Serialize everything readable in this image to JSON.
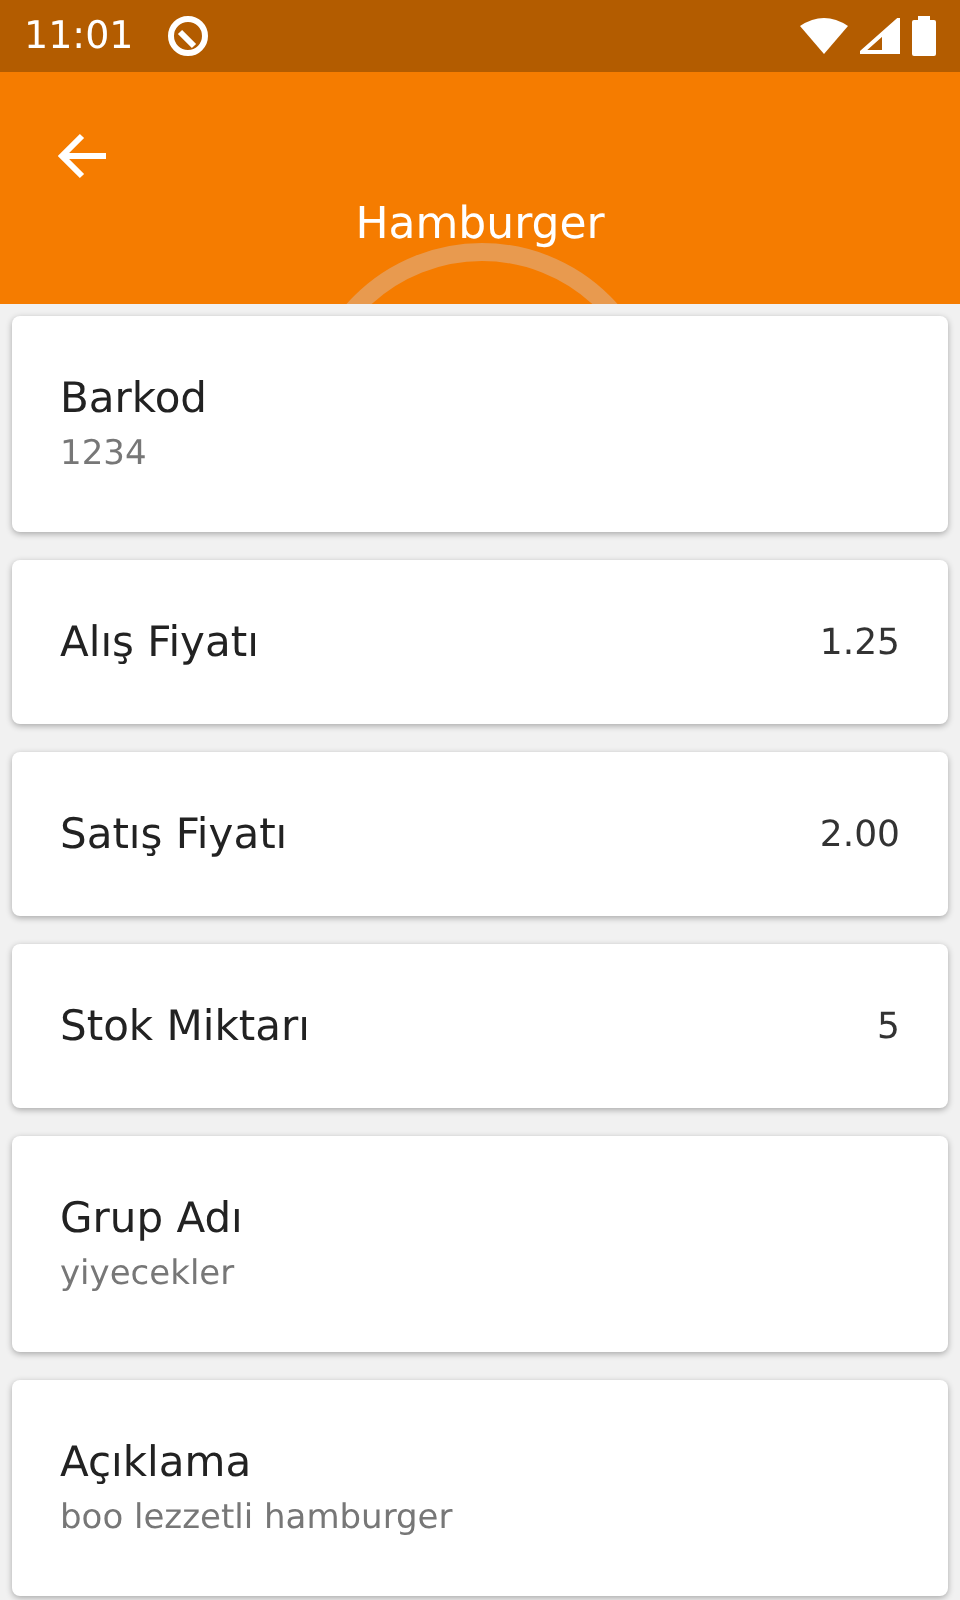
{
  "status_bar": {
    "time": "11:01"
  },
  "app_bar": {
    "title": "Hamburger"
  },
  "fields": [
    {
      "kind": "stacked",
      "label": "Barkod",
      "value": "1234"
    },
    {
      "kind": "inline",
      "label": "Alış Fiyatı",
      "value": "1.25"
    },
    {
      "kind": "inline",
      "label": "Satış Fiyatı",
      "value": "2.00"
    },
    {
      "kind": "inline",
      "label": "Stok Miktarı",
      "value": "5"
    },
    {
      "kind": "stacked",
      "label": "Grup Adı",
      "value": "yiyecekler"
    },
    {
      "kind": "stacked",
      "label": "Açıklama",
      "value": "boo lezzetli hamburger"
    }
  ]
}
